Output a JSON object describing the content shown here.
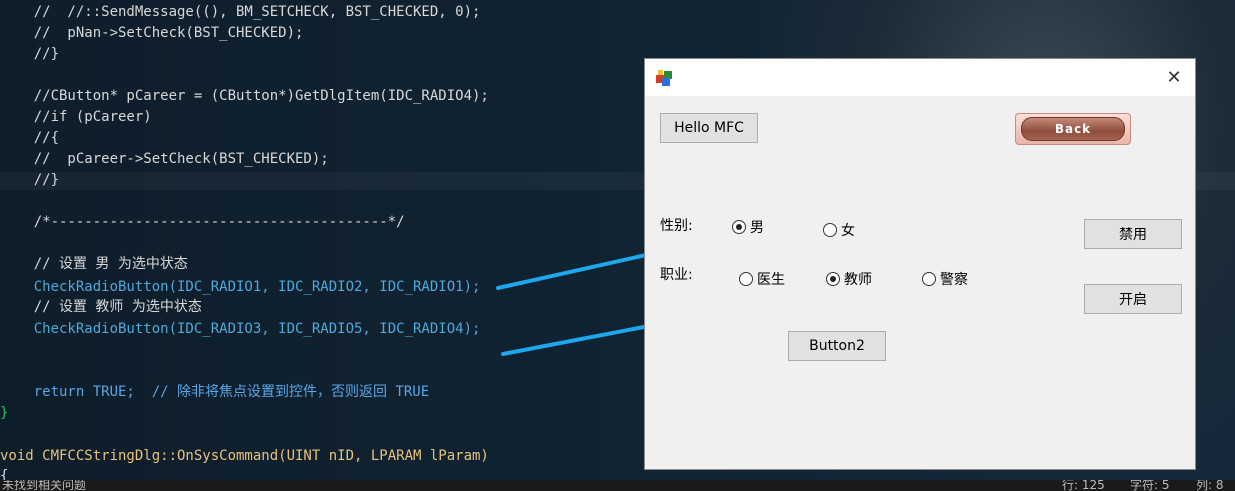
{
  "editor": {
    "lines": [
      {
        "text": "    //  //::SendMessage((), BM_SETCHECK, BST_CHECKED, 0);",
        "style": "c-comment"
      },
      {
        "text": "    //  pNan->SetCheck(BST_CHECKED);",
        "style": "c-comment"
      },
      {
        "text": "    //}",
        "style": "c-comment"
      },
      {
        "text": "",
        "style": "c-comment"
      },
      {
        "text": "    //CButton* pCareer = (CButton*)GetDlgItem(IDC_RADIO4);",
        "style": "c-comment"
      },
      {
        "text": "    //if (pCareer)",
        "style": "c-comment"
      },
      {
        "text": "    //{",
        "style": "c-comment"
      },
      {
        "text": "    //  pCareer->SetCheck(BST_CHECKED);",
        "style": "c-comment"
      },
      {
        "text": "    //}",
        "style": "c-comment"
      },
      {
        "text": "",
        "style": "c-comment"
      },
      {
        "text": "    /*----------------------------------------*/",
        "style": "c-comment"
      },
      {
        "text": "",
        "style": "c-comment"
      },
      {
        "text": "    // 设置 男 为选中状态",
        "style": "c-comment"
      },
      {
        "text": "    CheckRadioButton(IDC_RADIO1, IDC_RADIO2, IDC_RADIO1);",
        "style": "c-func"
      },
      {
        "text": "    // 设置 教师 为选中状态",
        "style": "c-comment"
      },
      {
        "text": "    CheckRadioButton(IDC_RADIO3, IDC_RADIO5, IDC_RADIO4);",
        "style": "c-func"
      },
      {
        "text": "",
        "style": "c-comment"
      },
      {
        "text": "",
        "style": "c-comment"
      },
      {
        "text": "    return TRUE;  // 除非将焦点设置到控件，否则返回 TRUE",
        "style": "c-kw"
      },
      {
        "text": "}",
        "style": "c-gutter"
      },
      {
        "text": "",
        "style": "c-comment"
      },
      {
        "text": "void CMFCCStringDlg::OnSysCommand(UINT nID, LPARAM lParam)",
        "style": "c-type"
      },
      {
        "text": "{",
        "style": "c-comment"
      }
    ]
  },
  "statusbar": {
    "problems": "未找到相关问题",
    "line": "行: 125",
    "char": "字符: 5",
    "col": "列: 8"
  },
  "dialog": {
    "close_glyph": "✕",
    "hello_label": "Hello MFC",
    "back_label": "Back",
    "gender_label": "性别:",
    "gender_options": [
      {
        "label": "男",
        "checked": true
      },
      {
        "label": "女",
        "checked": false
      }
    ],
    "career_label": "职业:",
    "career_options": [
      {
        "label": "医生",
        "checked": false
      },
      {
        "label": "教师",
        "checked": true
      },
      {
        "label": "警察",
        "checked": false
      }
    ],
    "disable_label": "禁用",
    "enable_label": "开启",
    "button2_label": "Button2"
  },
  "colors": {
    "arrow": "#1ea7ec",
    "editor_bg": "#0f1f2c"
  }
}
